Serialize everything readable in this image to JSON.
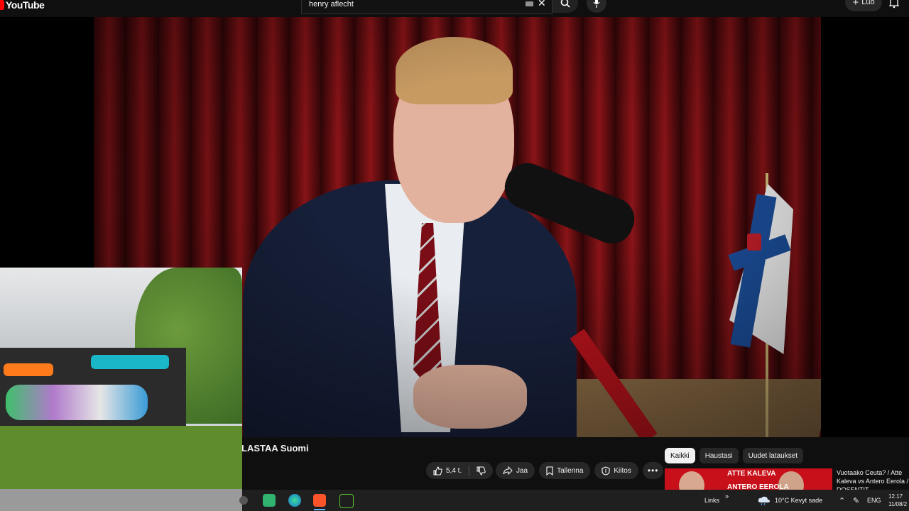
{
  "header": {
    "logo_text": "YouTube",
    "search_value": "henry aflecht",
    "create_label": "Luo"
  },
  "video": {
    "title": "LASTAA Suomi"
  },
  "actions": {
    "like_count": "5,4 t.",
    "share_label": "Jaa",
    "save_label": "Tallenna",
    "thanks_label": "Kiitos"
  },
  "filters": {
    "chips": [
      "Kaikki",
      "Haustasi",
      "Uudet lataukset"
    ],
    "active": "Kaikki"
  },
  "recommendation": {
    "thumb_line1": "ATTE KALEVA",
    "thumb_line2": "ANTERO EEROLA",
    "title": "Vuotaako Ceuta? / Atte Kaleva vs Antero Eerola / DOSENTIT"
  },
  "taskbar": {
    "links_label": "Links",
    "weather": "10°C  Kevyt sade",
    "language": "ENG",
    "time": "12.17",
    "date": "11/08/2"
  },
  "colors": {
    "brand_red": "#ff0000",
    "background": "#0f0f0f",
    "chip_active": "#f1f1f1"
  }
}
